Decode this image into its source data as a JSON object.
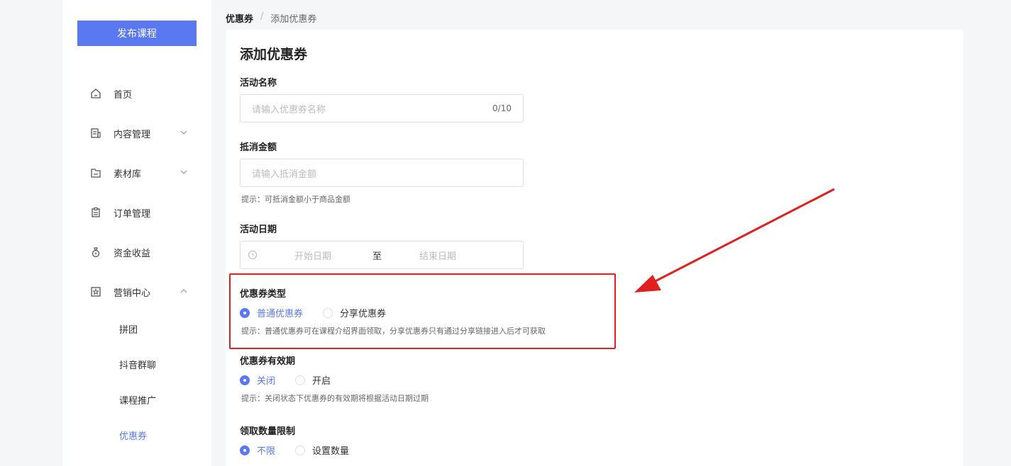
{
  "sidebar": {
    "publish_label": "发布课程",
    "items": [
      {
        "label": "首页",
        "icon": "home-icon"
      },
      {
        "label": "内容管理",
        "icon": "content-icon"
      },
      {
        "label": "素材库",
        "icon": "folder-icon"
      },
      {
        "label": "订单管理",
        "icon": "clipboard-icon"
      },
      {
        "label": "资金收益",
        "icon": "money-bag-icon"
      },
      {
        "label": "营销中心",
        "icon": "star-icon"
      }
    ],
    "sub_items": [
      "拼团",
      "抖音群聊",
      "课程推广",
      "优惠券"
    ]
  },
  "breadcrumb": {
    "root": "优惠券",
    "sep": "/",
    "current": "添加优惠券"
  },
  "form": {
    "title": "添加优惠券",
    "name_label": "活动名称",
    "name_placeholder": "请输入优惠券名称",
    "name_count": "0/10",
    "amount_label": "抵消金额",
    "amount_placeholder": "请输入抵消金额",
    "amount_hint": "提示：可抵消金额小于商品金额",
    "date_label": "活动日期",
    "date_start": "开始日期",
    "date_to": "至",
    "date_end": "结束日期",
    "type_label": "优惠券类型",
    "type_opt1": "普通优惠券",
    "type_opt2": "分享优惠券",
    "type_hint": "提示：普通优惠券可在课程介绍界面领取，分享优惠券只有通过分享链接进入后才可获取",
    "validity_label": "优惠券有效期",
    "validity_opt1": "关闭",
    "validity_opt2": "开启",
    "validity_hint": "提示：关闭状态下优惠券的有效期将根据活动日期过期",
    "limit_label": "领取数量限制",
    "limit_opt1": "不限",
    "limit_opt2": "设置数量"
  },
  "colors": {
    "accent": "#5a78f0",
    "annotation": "#e02020"
  }
}
